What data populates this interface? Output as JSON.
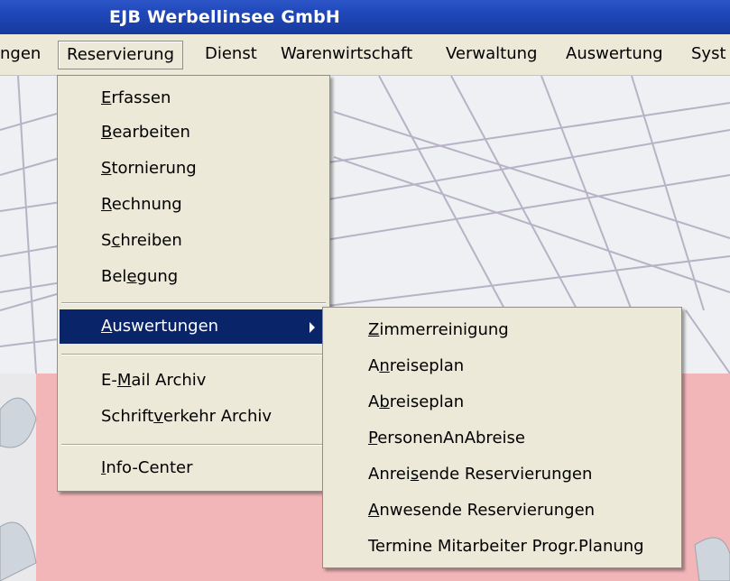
{
  "window": {
    "title": "EJB Werbellinsee GmbH"
  },
  "menubar": {
    "items": [
      {
        "label": "ngen"
      },
      {
        "label": "Reservierung"
      },
      {
        "label": "Dienst"
      },
      {
        "label": "Warenwirtschaft"
      },
      {
        "label": "Verwaltung"
      },
      {
        "label": "Auswertung"
      },
      {
        "label": "Syst"
      }
    ]
  },
  "reservierung_menu": {
    "items": [
      {
        "pre": "",
        "u": "E",
        "post": "rfassen"
      },
      {
        "pre": "",
        "u": "B",
        "post": "earbeiten"
      },
      {
        "pre": "",
        "u": "S",
        "post": "tornierung"
      },
      {
        "pre": "",
        "u": "R",
        "post": "echnung"
      },
      {
        "pre": "S",
        "u": "c",
        "post": "hreiben"
      },
      {
        "pre": "Bel",
        "u": "e",
        "post": "gung"
      },
      {
        "pre": "",
        "u": "A",
        "post": "uswertungen"
      },
      {
        "pre": "E-",
        "u": "M",
        "post": "ail Archiv"
      },
      {
        "pre": "Schrift",
        "u": "v",
        "post": "erkehr Archiv"
      },
      {
        "pre": "",
        "u": "I",
        "post": "nfo-Center"
      }
    ]
  },
  "auswertungen_submenu": {
    "items": [
      {
        "pre": "",
        "u": "Z",
        "post": "immerreinigung"
      },
      {
        "pre": "A",
        "u": "n",
        "post": "reiseplan"
      },
      {
        "pre": "A",
        "u": "b",
        "post": "reiseplan"
      },
      {
        "pre": "",
        "u": "P",
        "post": "ersonenAnAbreise"
      },
      {
        "pre": "Anrei",
        "u": "s",
        "post": "ende Reservierungen"
      },
      {
        "pre": "",
        "u": "A",
        "post": "nwesende Reservierungen"
      },
      {
        "pre": "",
        "u": "",
        "post": "Termine Mitarbeiter Progr.Planung"
      }
    ]
  },
  "colors": {
    "highlight": "#0a246a",
    "menu_bg": "#ece9d8",
    "titlebar": "#1f47b8"
  }
}
